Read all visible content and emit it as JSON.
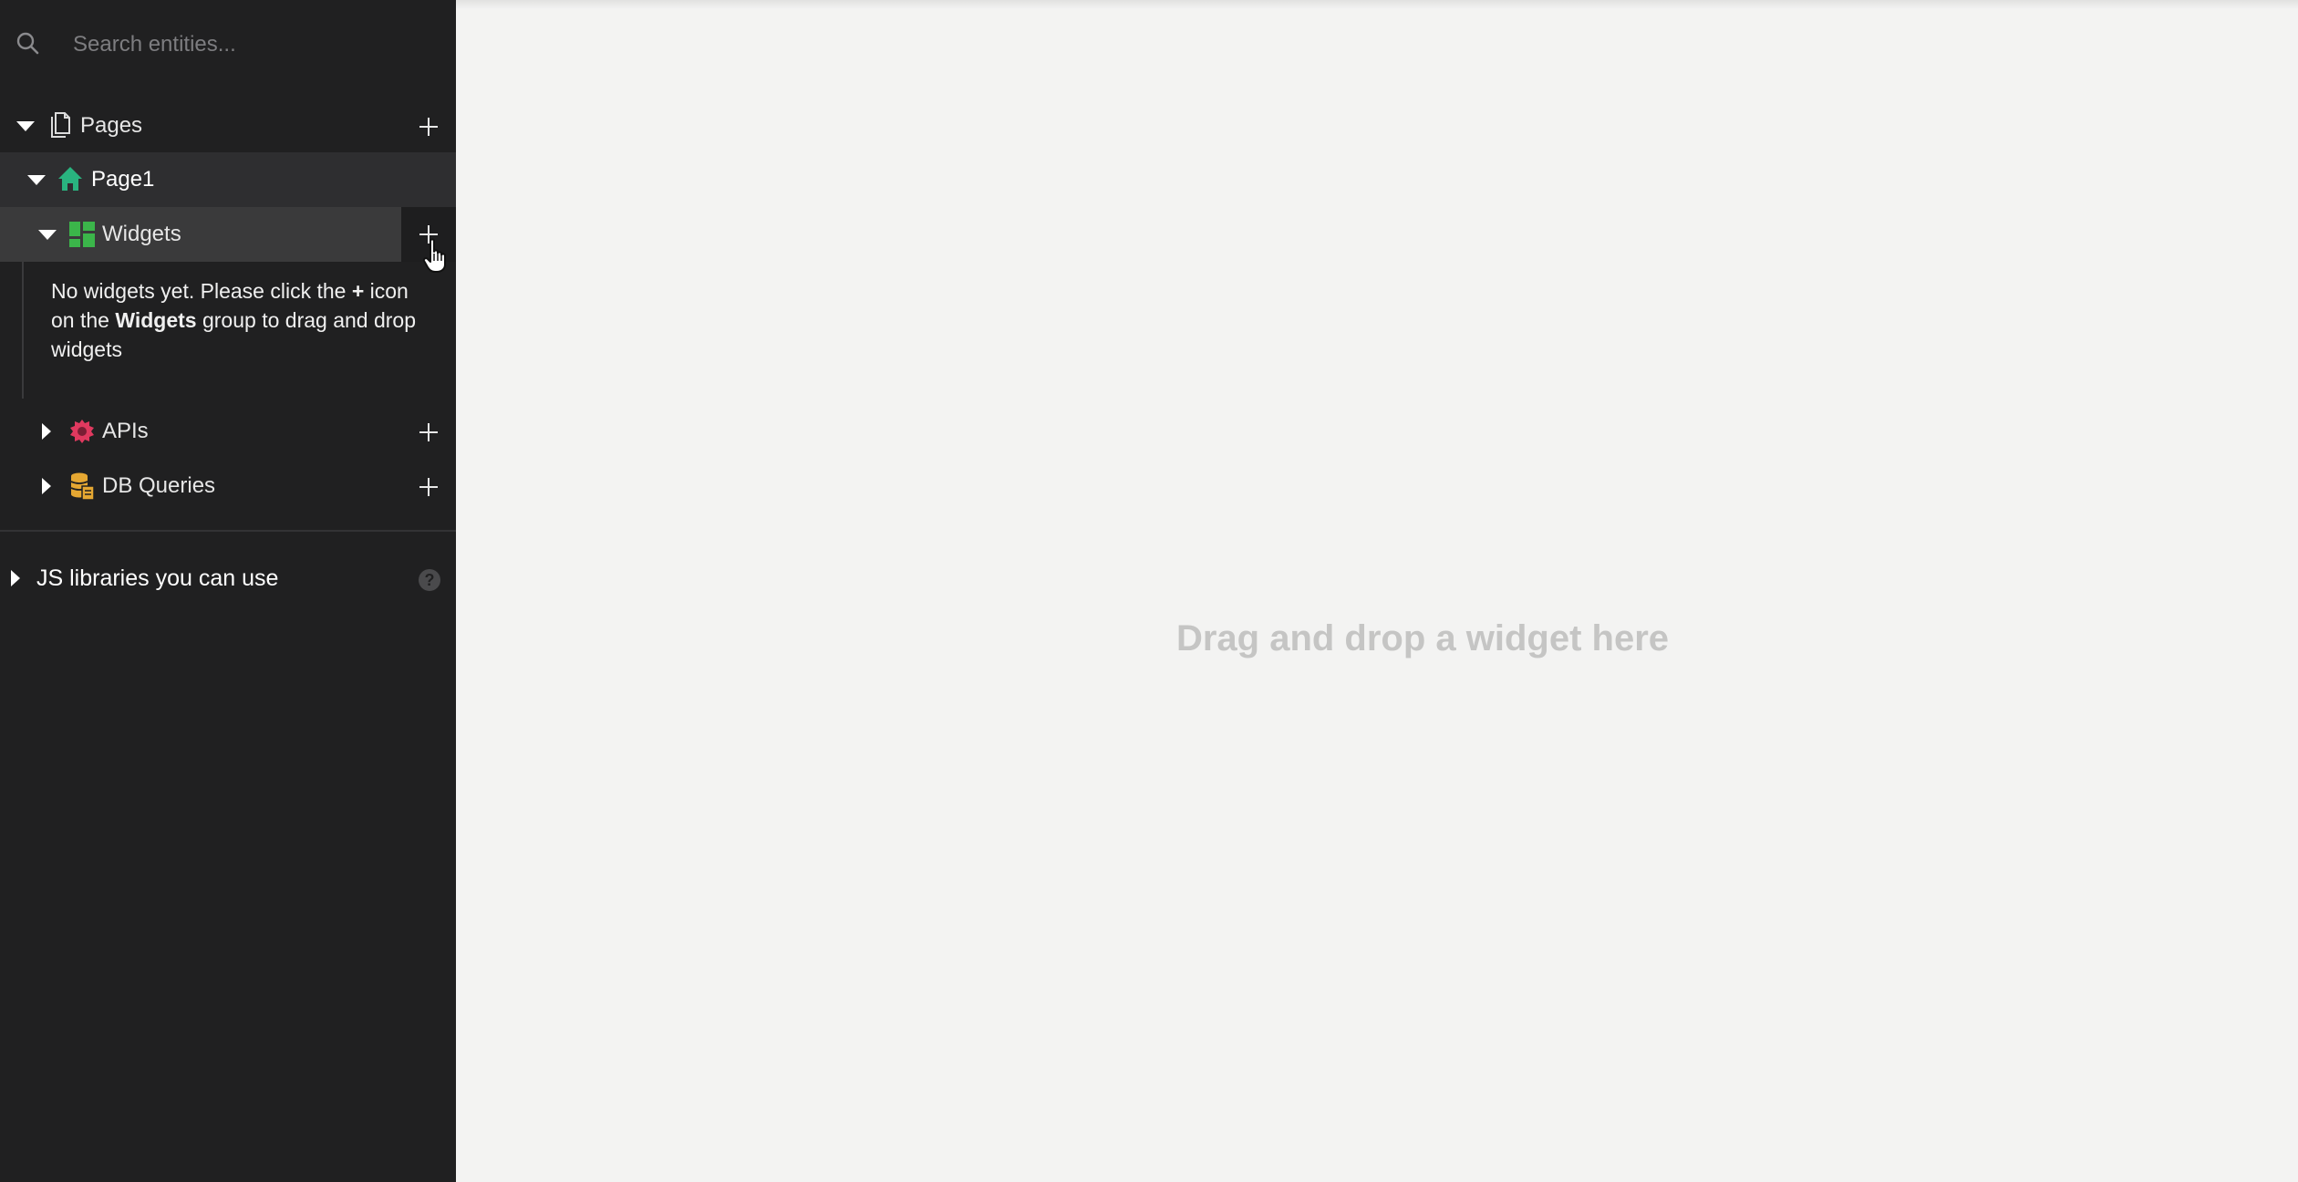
{
  "sidebar": {
    "search": {
      "placeholder": "Search entities...",
      "value": ""
    },
    "pages": {
      "label": "Pages",
      "icon": "document-icon"
    },
    "page1": {
      "label": "Page1",
      "icon": "home-icon",
      "icon_color": "#29b47f"
    },
    "widgets": {
      "label": "Widgets",
      "icon": "widgets-grid-icon",
      "icon_color": "#3bb54a",
      "empty_message": {
        "part1": "No widgets yet. Please click the ",
        "plus": "+",
        "part2": " icon on the ",
        "bold": "Widgets",
        "part3": " group to drag and drop widgets"
      }
    },
    "apis": {
      "label": "APIs",
      "icon": "api-gear-icon",
      "icon_color": "#e0395f"
    },
    "db_queries": {
      "label": "DB Queries",
      "icon": "database-icon",
      "icon_color": "#e5a732"
    },
    "js_libraries": {
      "label": "JS libraries you can use",
      "help": "?"
    }
  },
  "canvas": {
    "drop_hint": "Drag and drop a widget here"
  }
}
